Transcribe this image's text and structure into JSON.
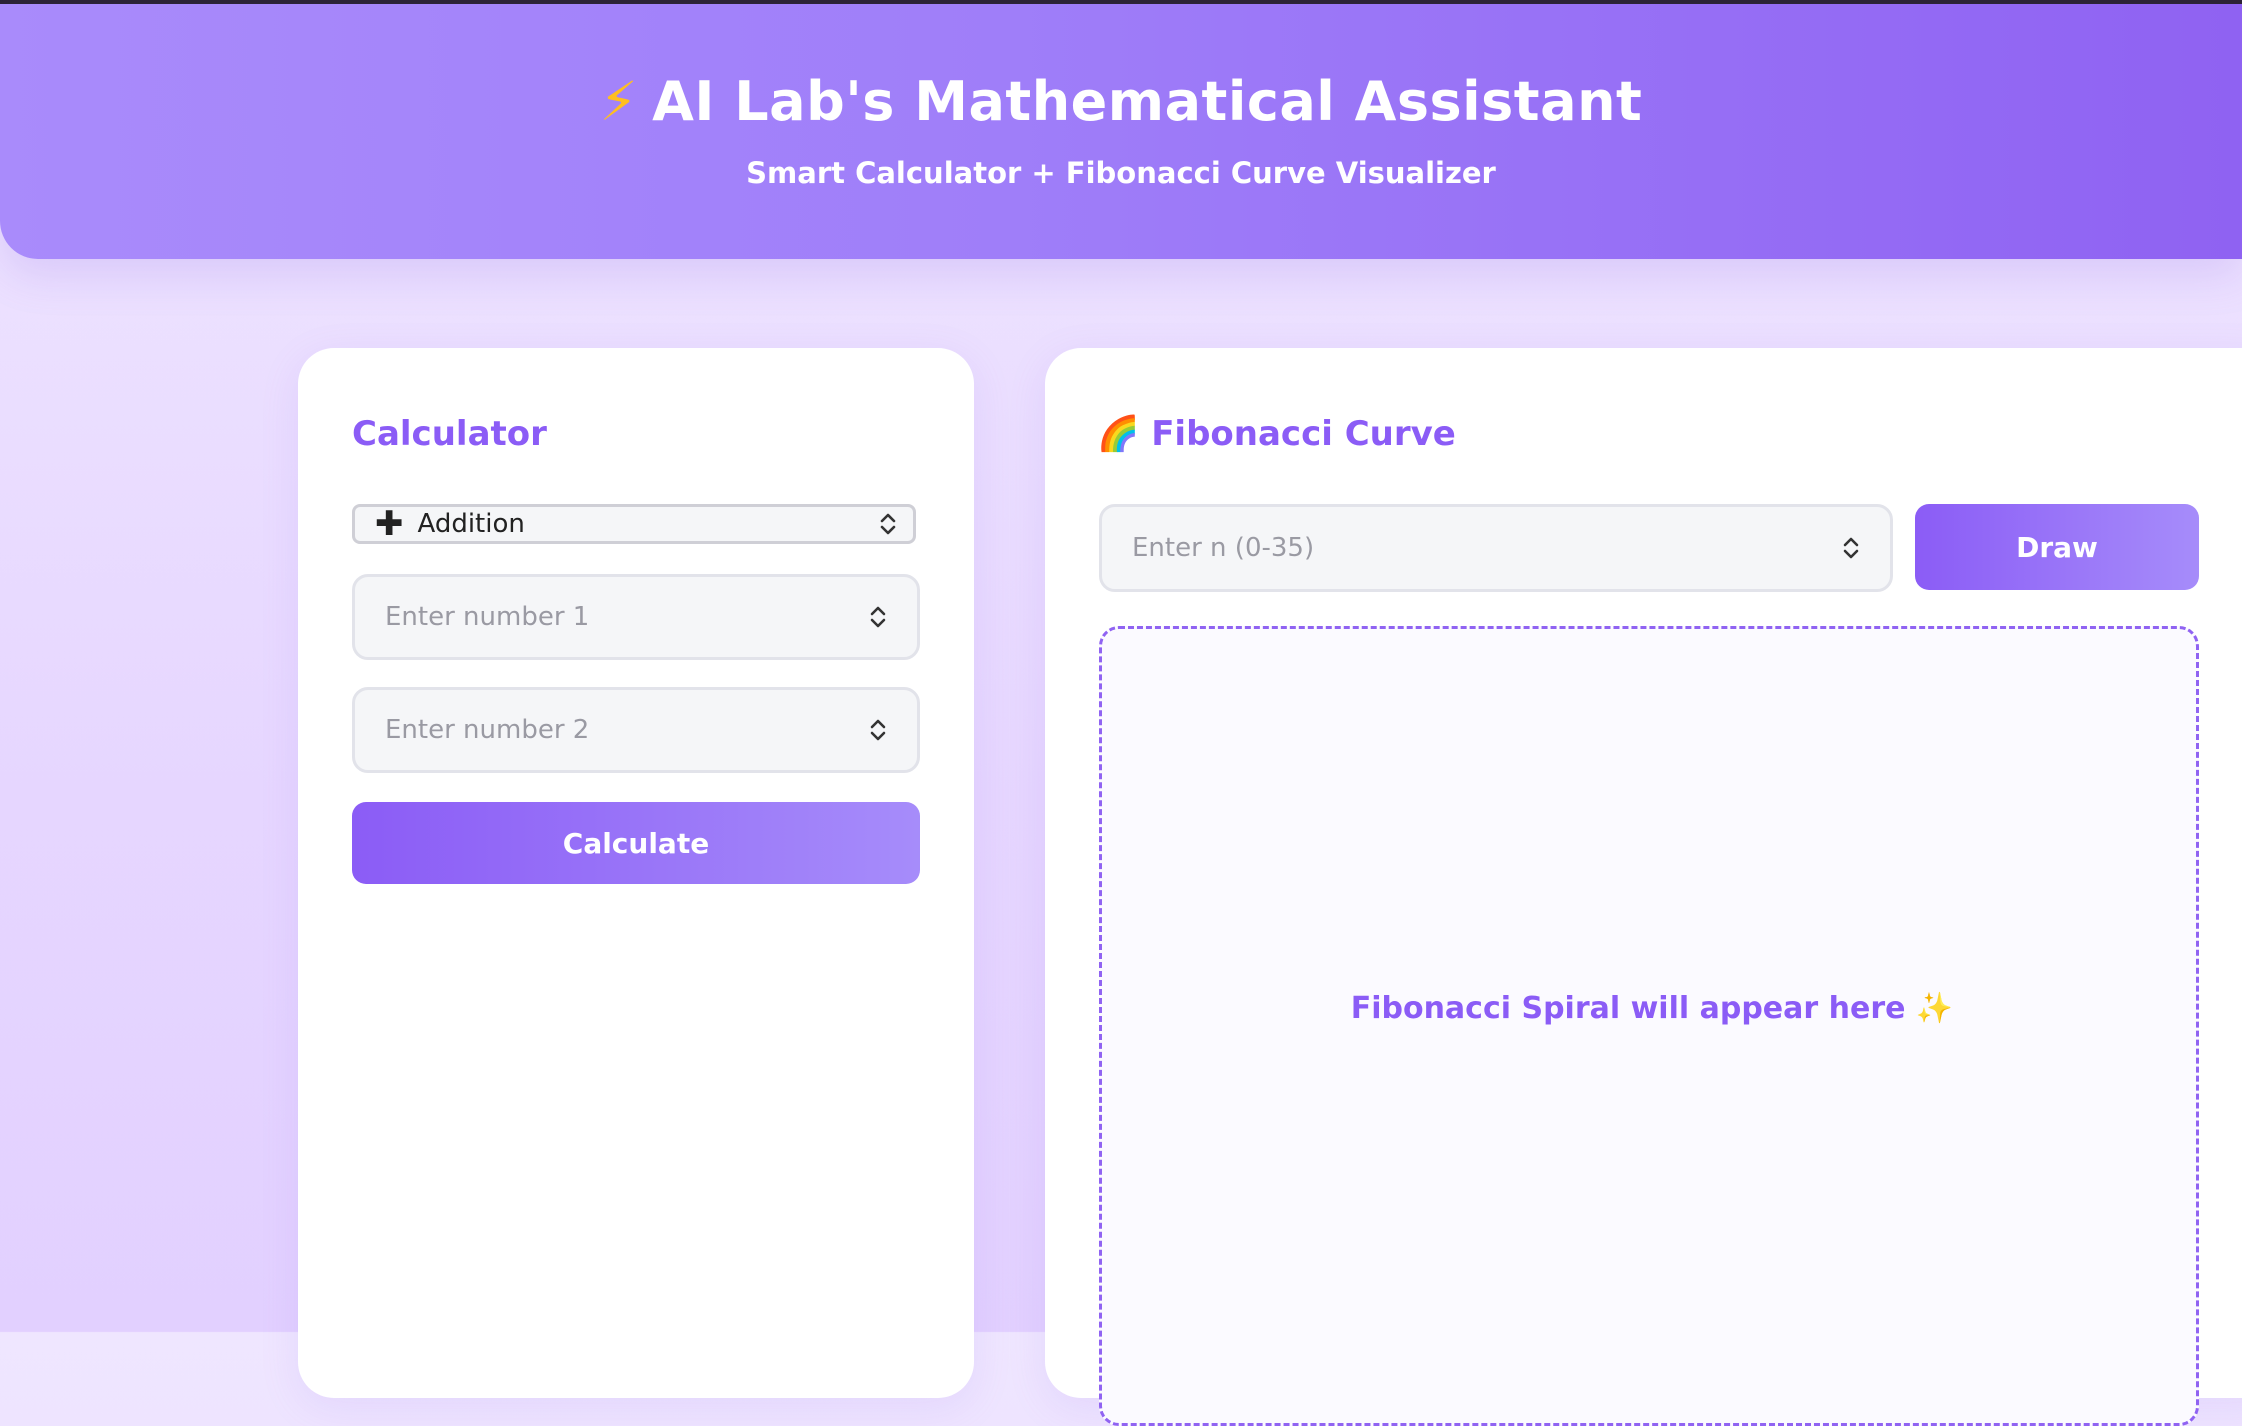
{
  "header": {
    "title": "AI Lab's Mathematical Assistant",
    "subtitle": "Smart Calculator + Fibonacci Curve Visualizer",
    "title_icon": "lightning-icon"
  },
  "calculator": {
    "title": "Calculator",
    "operation_select": {
      "icon": "plus-icon",
      "selected": "Addition"
    },
    "number1_placeholder": "Enter number 1",
    "number2_placeholder": "Enter number 2",
    "calculate_label": "Calculate"
  },
  "fibonacci": {
    "title": "Fibonacci Curve",
    "title_icon": "rainbow-icon",
    "n_placeholder": "Enter n (0-35)",
    "draw_label": "Draw",
    "canvas_placeholder": "Fibonacci Spiral will appear here",
    "placeholder_icon": "sparkles-icon"
  },
  "colors": {
    "accent": "#8b5cf6",
    "header_start": "#a98bfb",
    "header_end": "#8f62f2",
    "background": "#e8dbff"
  }
}
